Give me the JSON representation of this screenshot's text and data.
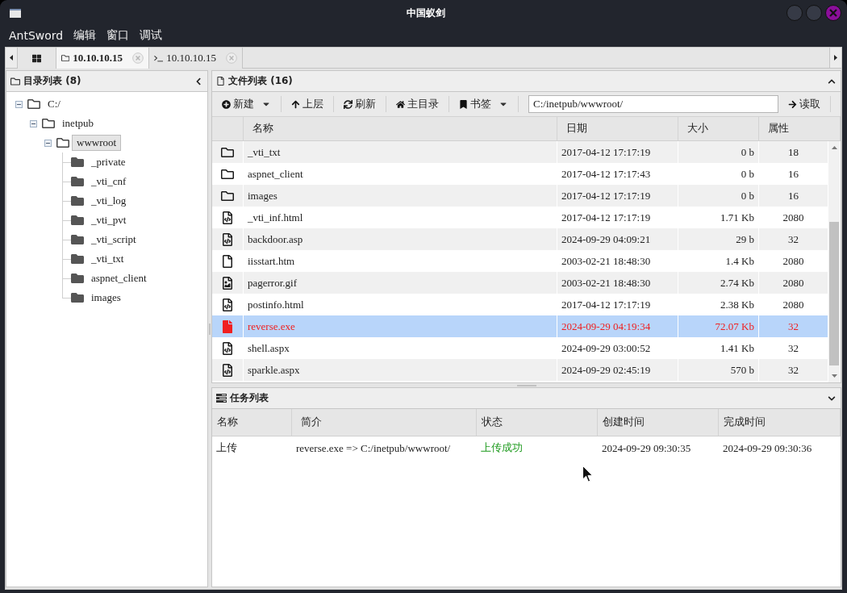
{
  "window": {
    "title": "中国蚁剑"
  },
  "menu": [
    {
      "label": "AntSword"
    },
    {
      "label": "编辑"
    },
    {
      "label": "窗口"
    },
    {
      "label": "调试"
    }
  ],
  "tabs": [
    {
      "kind": "dashboard",
      "selected": false,
      "closable": false
    },
    {
      "kind": "files",
      "label": "10.10.10.15",
      "selected": true,
      "closable": true
    },
    {
      "kind": "terminal",
      "label": "10.10.10.15",
      "selected": false,
      "closable": true
    }
  ],
  "directory_panel": {
    "title": "目录列表 (8)",
    "tree": [
      {
        "label": "C:/",
        "expanded": true,
        "selected": false,
        "children": [
          {
            "label": "inetpub",
            "expanded": true,
            "selected": false,
            "children": [
              {
                "label": "wwwroot",
                "expanded": true,
                "selected": true,
                "children": [
                  {
                    "label": "_private",
                    "expanded": false,
                    "selected": false
                  },
                  {
                    "label": "_vti_cnf",
                    "expanded": false,
                    "selected": false
                  },
                  {
                    "label": "_vti_log",
                    "expanded": false,
                    "selected": false
                  },
                  {
                    "label": "_vti_pvt",
                    "expanded": false,
                    "selected": false
                  },
                  {
                    "label": "_vti_script",
                    "expanded": false,
                    "selected": false
                  },
                  {
                    "label": "_vti_txt",
                    "expanded": false,
                    "selected": false
                  },
                  {
                    "label": "aspnet_client",
                    "expanded": false,
                    "selected": false
                  },
                  {
                    "label": "images",
                    "expanded": false,
                    "selected": false
                  }
                ]
              }
            ]
          }
        ]
      }
    ]
  },
  "file_panel": {
    "title": "文件列表 (16)",
    "toolbar": [
      {
        "kind": "new",
        "label": "新建",
        "dropdown": true
      },
      {
        "kind": "up",
        "label": "上层",
        "dropdown": false
      },
      {
        "kind": "refresh",
        "label": "刷新",
        "dropdown": false
      },
      {
        "kind": "home",
        "label": "主目录",
        "dropdown": false
      },
      {
        "kind": "bookmark",
        "label": "书签",
        "dropdown": true
      }
    ],
    "path": "C:/inetpub/wwwroot/",
    "read_button": "读取",
    "columns": [
      "名称",
      "日期",
      "大小",
      "属性"
    ],
    "rows": [
      {
        "kind": "folder",
        "name": "_vti_txt",
        "date": "2017-04-12 17:17:19",
        "size": "0 b",
        "attr": "18",
        "selected": false
      },
      {
        "kind": "folder",
        "name": "aspnet_client",
        "date": "2017-04-12 17:17:43",
        "size": "0 b",
        "attr": "16",
        "selected": false
      },
      {
        "kind": "folder",
        "name": "images",
        "date": "2017-04-12 17:17:19",
        "size": "0 b",
        "attr": "16",
        "selected": false
      },
      {
        "kind": "code",
        "name": "_vti_inf.html",
        "date": "2017-04-12 17:17:19",
        "size": "1.71 Kb",
        "attr": "2080",
        "selected": false
      },
      {
        "kind": "code",
        "name": "backdoor.asp",
        "date": "2024-09-29 04:09:21",
        "size": "29 b",
        "attr": "32",
        "selected": false
      },
      {
        "kind": "document",
        "name": "iisstart.htm",
        "date": "2003-02-21 18:48:30",
        "size": "1.4 Kb",
        "attr": "2080",
        "selected": false
      },
      {
        "kind": "image",
        "name": "pagerror.gif",
        "date": "2003-02-21 18:48:30",
        "size": "2.74 Kb",
        "attr": "2080",
        "selected": false
      },
      {
        "kind": "code",
        "name": "postinfo.html",
        "date": "2017-04-12 17:17:19",
        "size": "2.38 Kb",
        "attr": "2080",
        "selected": false
      },
      {
        "kind": "binary",
        "name": "reverse.exe",
        "date": "2024-09-29 04:19:34",
        "size": "72.07 Kb",
        "attr": "32",
        "selected": true
      },
      {
        "kind": "code",
        "name": "shell.aspx",
        "date": "2024-09-29 03:00:52",
        "size": "1.41 Kb",
        "attr": "32",
        "selected": false
      },
      {
        "kind": "code",
        "name": "sparkle.aspx",
        "date": "2024-09-29 02:45:19",
        "size": "570 b",
        "attr": "32",
        "selected": false
      }
    ]
  },
  "task_panel": {
    "title": "任务列表",
    "columns": [
      "名称",
      "简介",
      "状态",
      "创建时间",
      "完成时间"
    ],
    "rows": [
      {
        "name": "上传",
        "description": "reverse.exe => C:/inetpub/wwwroot/",
        "status": "上传成功",
        "succeeded": true,
        "created": "2024-09-29 09:30:35",
        "finished": "2024-09-29 09:30:36"
      }
    ]
  }
}
